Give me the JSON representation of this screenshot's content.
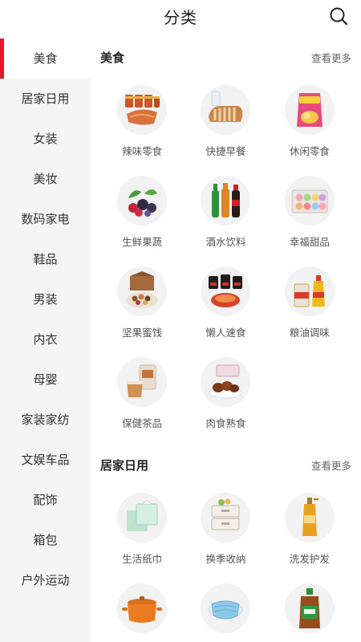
{
  "header": {
    "title": "分类",
    "search_icon": "search-icon"
  },
  "sidebar": {
    "active_index": 0,
    "items": [
      {
        "label": "美食"
      },
      {
        "label": "居家日用"
      },
      {
        "label": "女装"
      },
      {
        "label": "美妆"
      },
      {
        "label": "数码家电"
      },
      {
        "label": "鞋品"
      },
      {
        "label": "男装"
      },
      {
        "label": "内衣"
      },
      {
        "label": "母婴"
      },
      {
        "label": "家装家纺"
      },
      {
        "label": "文娱车品"
      },
      {
        "label": "配饰"
      },
      {
        "label": "箱包"
      },
      {
        "label": "户外运动"
      }
    ]
  },
  "sections": [
    {
      "title": "美食",
      "more": "查看更多",
      "items": [
        {
          "label": "辣味零食",
          "icon": "spicy-snack-icon"
        },
        {
          "label": "快捷早餐",
          "icon": "bread-icon"
        },
        {
          "label": "休闲零食",
          "icon": "chips-bag-icon"
        },
        {
          "label": "生鲜果蔬",
          "icon": "berries-icon"
        },
        {
          "label": "酒水饮料",
          "icon": "drink-bottles-icon"
        },
        {
          "label": "幸福甜品",
          "icon": "macaron-box-icon"
        },
        {
          "label": "坚果蜜饯",
          "icon": "nuts-icon"
        },
        {
          "label": "懒人速食",
          "icon": "instant-noodle-icon"
        },
        {
          "label": "粮油调味",
          "icon": "oil-rice-icon"
        },
        {
          "label": "保健茶品",
          "icon": "tea-icon"
        },
        {
          "label": "肉食熟食",
          "icon": "braised-meat-icon"
        }
      ]
    },
    {
      "title": "居家日用",
      "more": "查看更多",
      "items": [
        {
          "label": "生活纸巾",
          "icon": "tissue-box-icon"
        },
        {
          "label": "换季收纳",
          "icon": "storage-drawer-icon"
        },
        {
          "label": "洗发护发",
          "icon": "shampoo-bottle-icon"
        },
        {
          "label": "",
          "icon": "cooking-pot-icon"
        },
        {
          "label": "",
          "icon": "face-mask-icon"
        },
        {
          "label": "",
          "icon": "disinfectant-bottle-icon"
        }
      ]
    }
  ],
  "colors": {
    "accent": "#e4182c",
    "sidebar_bg": "#f5f5f5",
    "thumb_bg": "#f2f2f2"
  }
}
